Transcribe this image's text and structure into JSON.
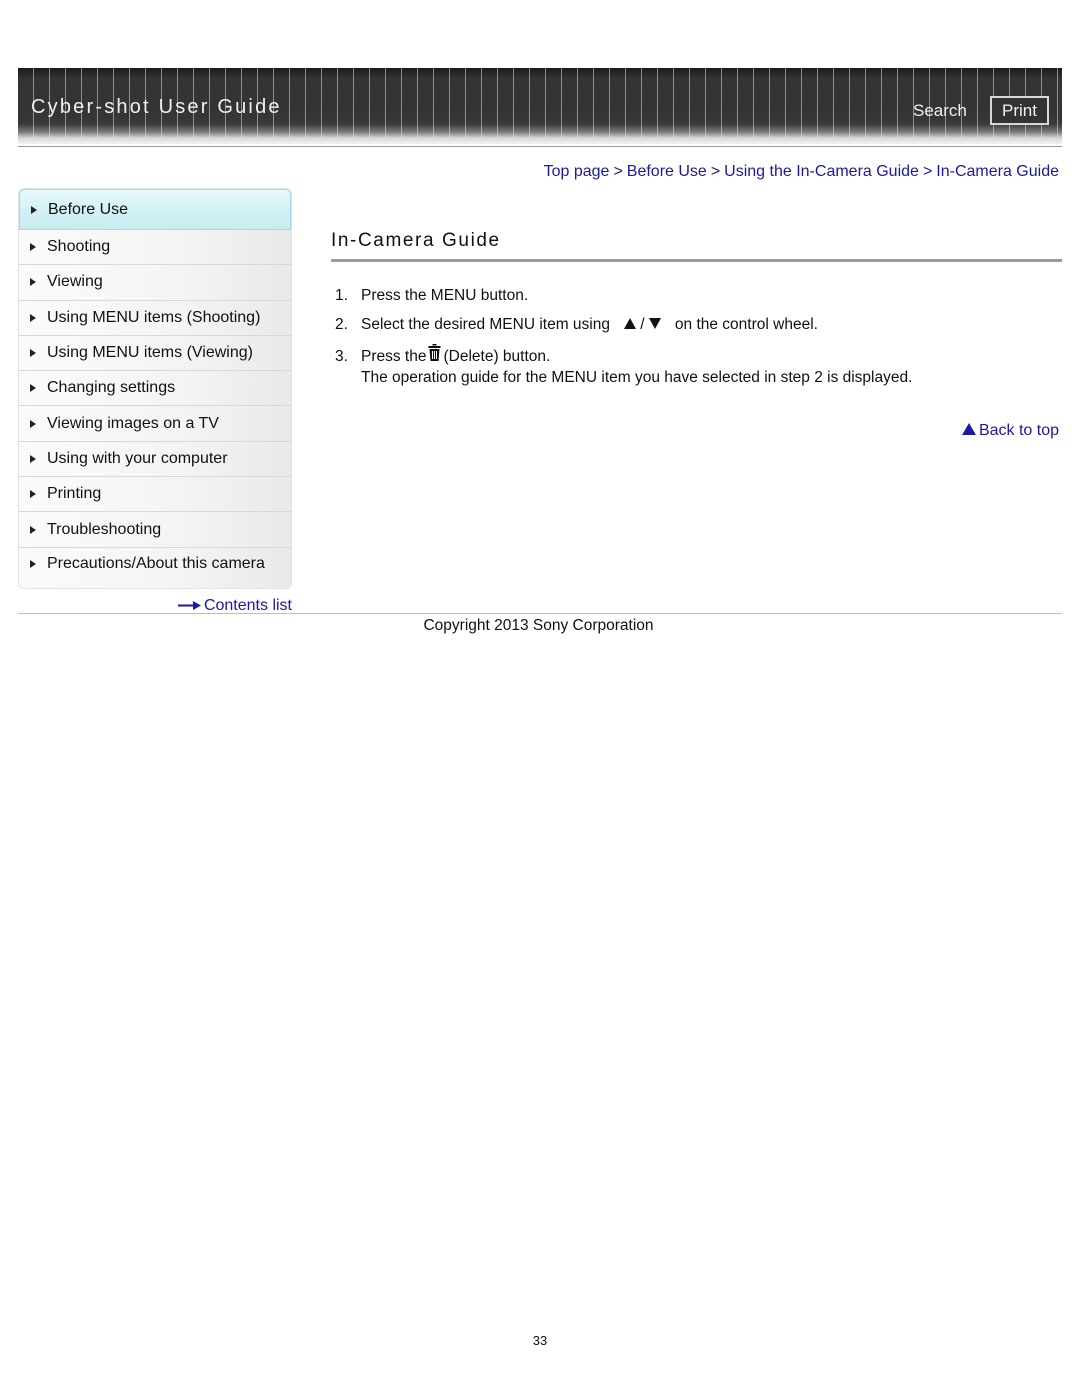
{
  "header": {
    "title": "Cyber-shot User Guide",
    "search_label": "Search",
    "print_label": "Print"
  },
  "breadcrumb": [
    {
      "label": "Top page"
    },
    {
      "label": "Before Use"
    },
    {
      "label": "Using the In-Camera Guide"
    },
    {
      "label": "In-Camera Guide"
    }
  ],
  "breadcrumb_separator": ">",
  "sidebar": {
    "items": [
      {
        "label": "Before Use",
        "active": true
      },
      {
        "label": "Shooting"
      },
      {
        "label": "Viewing"
      },
      {
        "label": "Using MENU items (Shooting)"
      },
      {
        "label": "Using MENU items (Viewing)"
      },
      {
        "label": "Changing settings"
      },
      {
        "label": "Viewing images on a TV"
      },
      {
        "label": "Using with your computer"
      },
      {
        "label": "Printing"
      },
      {
        "label": "Troubleshooting"
      },
      {
        "label": "Precautions/About this camera"
      }
    ],
    "contents_link": "Contents list"
  },
  "main": {
    "heading": "In-Camera Guide",
    "steps": [
      {
        "num": "1.",
        "text": "Press the MENU button."
      },
      {
        "num": "2.",
        "text_before": "Select the desired MENU item using",
        "slash": "/",
        "text_after": "on the control wheel."
      },
      {
        "num": "3.",
        "text_before": "Press the",
        "text_after": "(Delete) button.",
        "note": "The operation guide for the MENU item you have selected in step 2 is displayed."
      }
    ],
    "back_to_top": "Back to top"
  },
  "footer": {
    "copyright": "Copyright 2013 Sony Corporation",
    "page_number": "33"
  },
  "colors": {
    "link": "#1a1aa0",
    "active_nav": "#d4f1f6",
    "banner": "#333333"
  }
}
